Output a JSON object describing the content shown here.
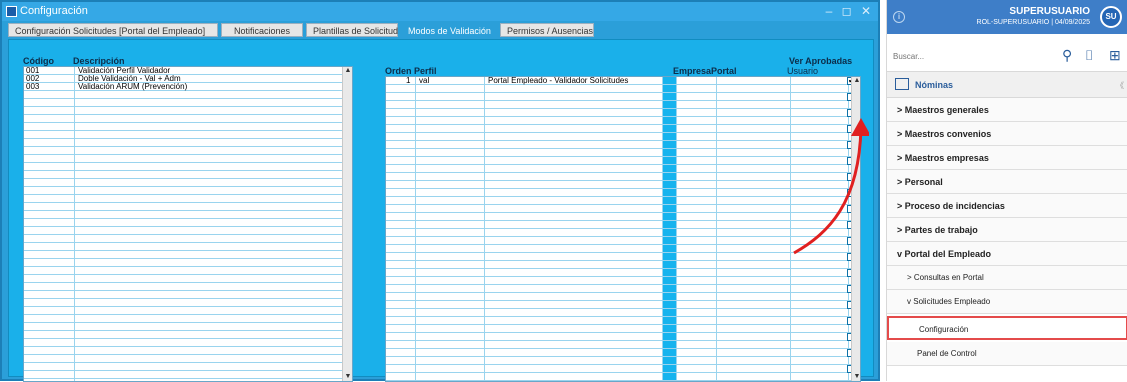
{
  "window": {
    "title": "Configuración",
    "controls": "– ◻ ✕",
    "tabs": [
      {
        "label": "Configuración Solicitudes [Portal del Empleado]",
        "active": false
      },
      {
        "label": "Notificaciones",
        "active": false
      },
      {
        "label": "Plantillas de Solicitud",
        "active": false
      },
      {
        "label": "Modos de Validación",
        "active": true
      },
      {
        "label": "Permisos / Ausencias",
        "active": false
      }
    ]
  },
  "left_table": {
    "headers": {
      "code": "Código",
      "description": "Descripción"
    },
    "rows": [
      {
        "code": "001",
        "description": "Validación Perfil Validador"
      },
      {
        "code": "002",
        "description": "Doble Validación - Val + Adm"
      },
      {
        "code": "003",
        "description": "Validación ARUM (Prevención)"
      }
    ]
  },
  "right_table": {
    "headers": {
      "order": "Orden",
      "profile": "Perfil",
      "company": "Empresa",
      "portal": "Portal",
      "user": "Usuario",
      "see_approved": "Ver Aprobadas"
    },
    "rows": [
      {
        "order": "1",
        "profile": "val",
        "description": "Portal Empleado - Validador Solicitudes",
        "company": "",
        "portal": "",
        "user": "",
        "approved": true
      }
    ]
  },
  "sidebar": {
    "user_name": "SUPERUSUARIO",
    "user_role": "ROL-SUPERUSUARIO | 04/09/2025",
    "avatar_initials": "SU",
    "search_placeholder": "Buscar...",
    "module": "Nóminas",
    "menu": [
      {
        "label": "Maestros generales",
        "prefix": ">",
        "level": 0
      },
      {
        "label": "Maestros convenios",
        "prefix": ">",
        "level": 0
      },
      {
        "label": "Maestros empresas",
        "prefix": ">",
        "level": 0
      },
      {
        "label": "Personal",
        "prefix": ">",
        "level": 0
      },
      {
        "label": "Proceso de incidencias",
        "prefix": ">",
        "level": 0
      },
      {
        "label": "Partes de trabajo",
        "prefix": ">",
        "level": 0
      },
      {
        "label": "Portal del Empleado",
        "prefix": "v",
        "level": 0
      },
      {
        "label": "Consultas en Portal",
        "prefix": ">",
        "level": 1
      },
      {
        "label": "Solicitudes Empleado",
        "prefix": "v",
        "level": 1
      },
      {
        "label": "Configuración",
        "prefix": "",
        "level": 2,
        "selected": true
      },
      {
        "label": "Panel de Control",
        "prefix": "",
        "level": 2
      }
    ]
  }
}
